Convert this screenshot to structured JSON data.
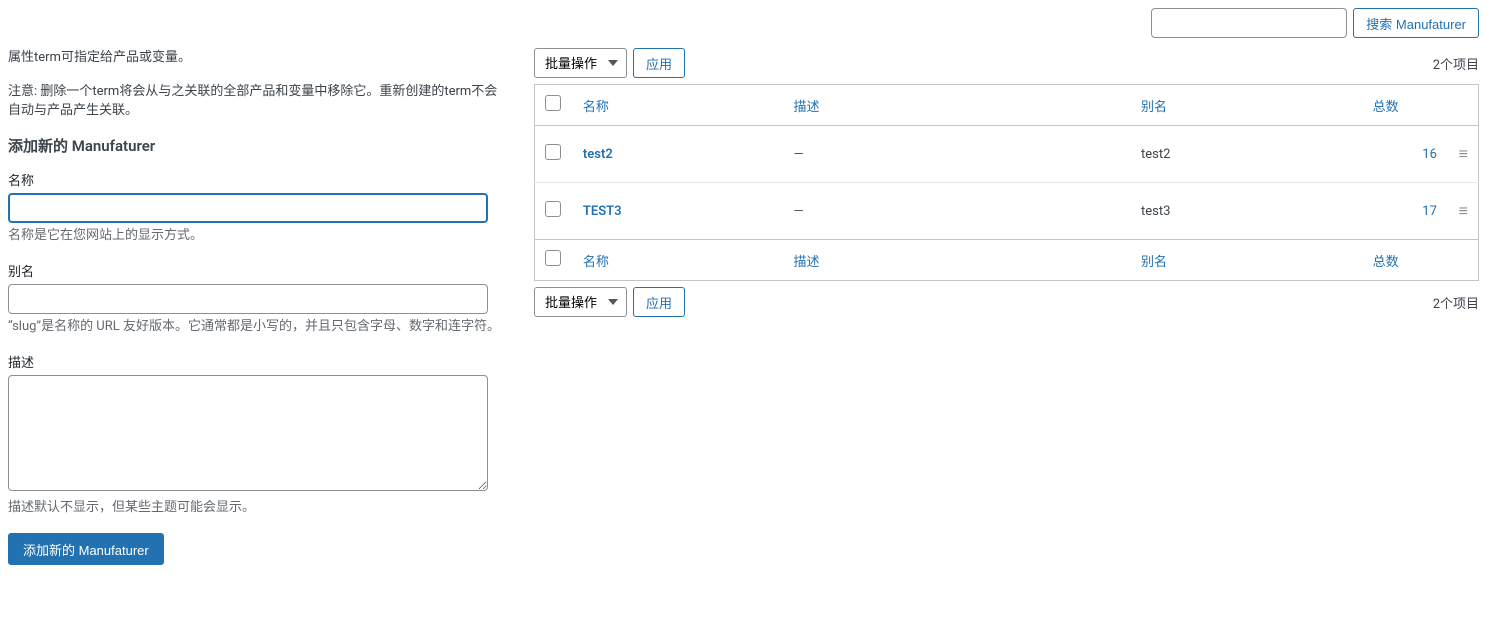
{
  "search": {
    "value": "",
    "button_label": "搜索 Manufaturer"
  },
  "left": {
    "intro": "属性term可指定给产品或变量。",
    "notice": "注意: 删除一个term将会从与之关联的全部产品和变量中移除它。重新创建的term不会自动与产品产生关联。",
    "heading": "添加新的 Manufaturer",
    "name_label": "名称",
    "name_value": "",
    "name_help": "名称是它在您网站上的显示方式。",
    "slug_label": "别名",
    "slug_value": "",
    "slug_help": "“slug”是名称的 URL 友好版本。它通常都是小写的，并且只包含字母、数字和连字符。",
    "desc_label": "描述",
    "desc_value": "",
    "desc_help": "描述默认不显示，但某些主题可能会显示。",
    "submit_label": "添加新的 Manufaturer"
  },
  "table": {
    "bulk_label": "批量操作",
    "apply_label": "应用",
    "item_count": "2个项目",
    "columns": {
      "name": "名称",
      "description": "描述",
      "slug": "别名",
      "count": "总数"
    },
    "rows": [
      {
        "name": "test2",
        "description": "—",
        "slug": "test2",
        "count": "16"
      },
      {
        "name": "TEST3",
        "description": "—",
        "slug": "test3",
        "count": "17"
      }
    ]
  }
}
